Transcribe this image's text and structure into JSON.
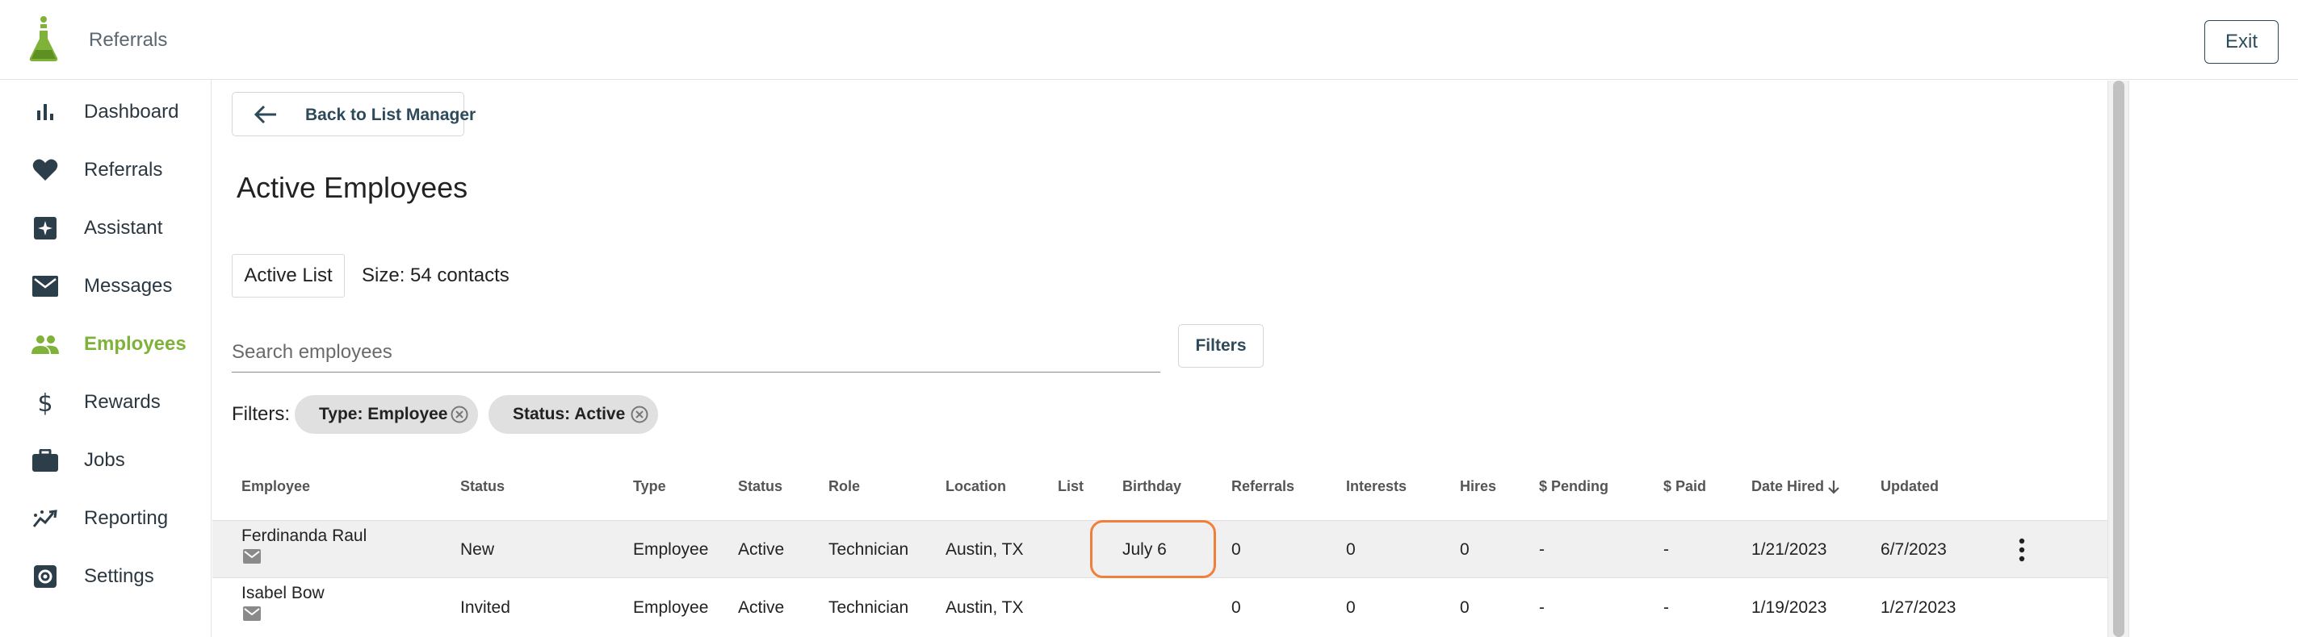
{
  "header": {
    "app_title": "Referrals",
    "exit_label": "Exit"
  },
  "sidebar": {
    "items": [
      {
        "label": "Dashboard",
        "icon": "bar-chart-icon"
      },
      {
        "label": "Referrals",
        "icon": "heart-icon"
      },
      {
        "label": "Assistant",
        "icon": "sparkle-icon"
      },
      {
        "label": "Messages",
        "icon": "mail-icon"
      },
      {
        "label": "Employees",
        "icon": "people-icon",
        "active": true
      },
      {
        "label": "Rewards",
        "icon": "dollar-icon"
      },
      {
        "label": "Jobs",
        "icon": "briefcase-icon"
      },
      {
        "label": "Reporting",
        "icon": "trend-icon"
      },
      {
        "label": "Settings",
        "icon": "gear-icon"
      }
    ]
  },
  "main": {
    "back_label": "Back to List Manager",
    "title": "Active Employees",
    "list_chip": "Active List",
    "size_text": "Size: 54 contacts",
    "search_placeholder": "Search employees",
    "filters_button": "Filters",
    "filters_label": "Filters:",
    "filter_chips": [
      "Type: Employee",
      "Status: Active"
    ]
  },
  "table": {
    "columns": [
      "Employee",
      "Status",
      "Type",
      "Status",
      "Role",
      "Location",
      "List",
      "Birthday",
      "Referrals",
      "Interests",
      "Hires",
      "$ Pending",
      "$ Paid",
      "Date Hired",
      "Updated"
    ],
    "rows": [
      {
        "employee": "Ferdinanda Raul",
        "status": "New",
        "type": "Employee",
        "status2": "Active",
        "role": "Technician",
        "location": "Austin, TX",
        "list": "",
        "birthday": "July 6",
        "referrals": "0",
        "interests": "0",
        "hires": "0",
        "pending": "-",
        "paid": "-",
        "date_hired": "1/21/2023",
        "updated": "6/7/2023"
      },
      {
        "employee": "Isabel Bow",
        "status": "Invited",
        "type": "Employee",
        "status2": "Active",
        "role": "Technician",
        "location": "Austin, TX",
        "list": "",
        "birthday": "",
        "referrals": "0",
        "interests": "0",
        "hires": "0",
        "pending": "-",
        "paid": "-",
        "date_hired": "1/19/2023",
        "updated": "1/27/2023"
      }
    ]
  },
  "colors": {
    "brand_green": "#7fb239",
    "highlight_orange": "#f07f3c",
    "nav_dark": "#2d4a5a"
  }
}
